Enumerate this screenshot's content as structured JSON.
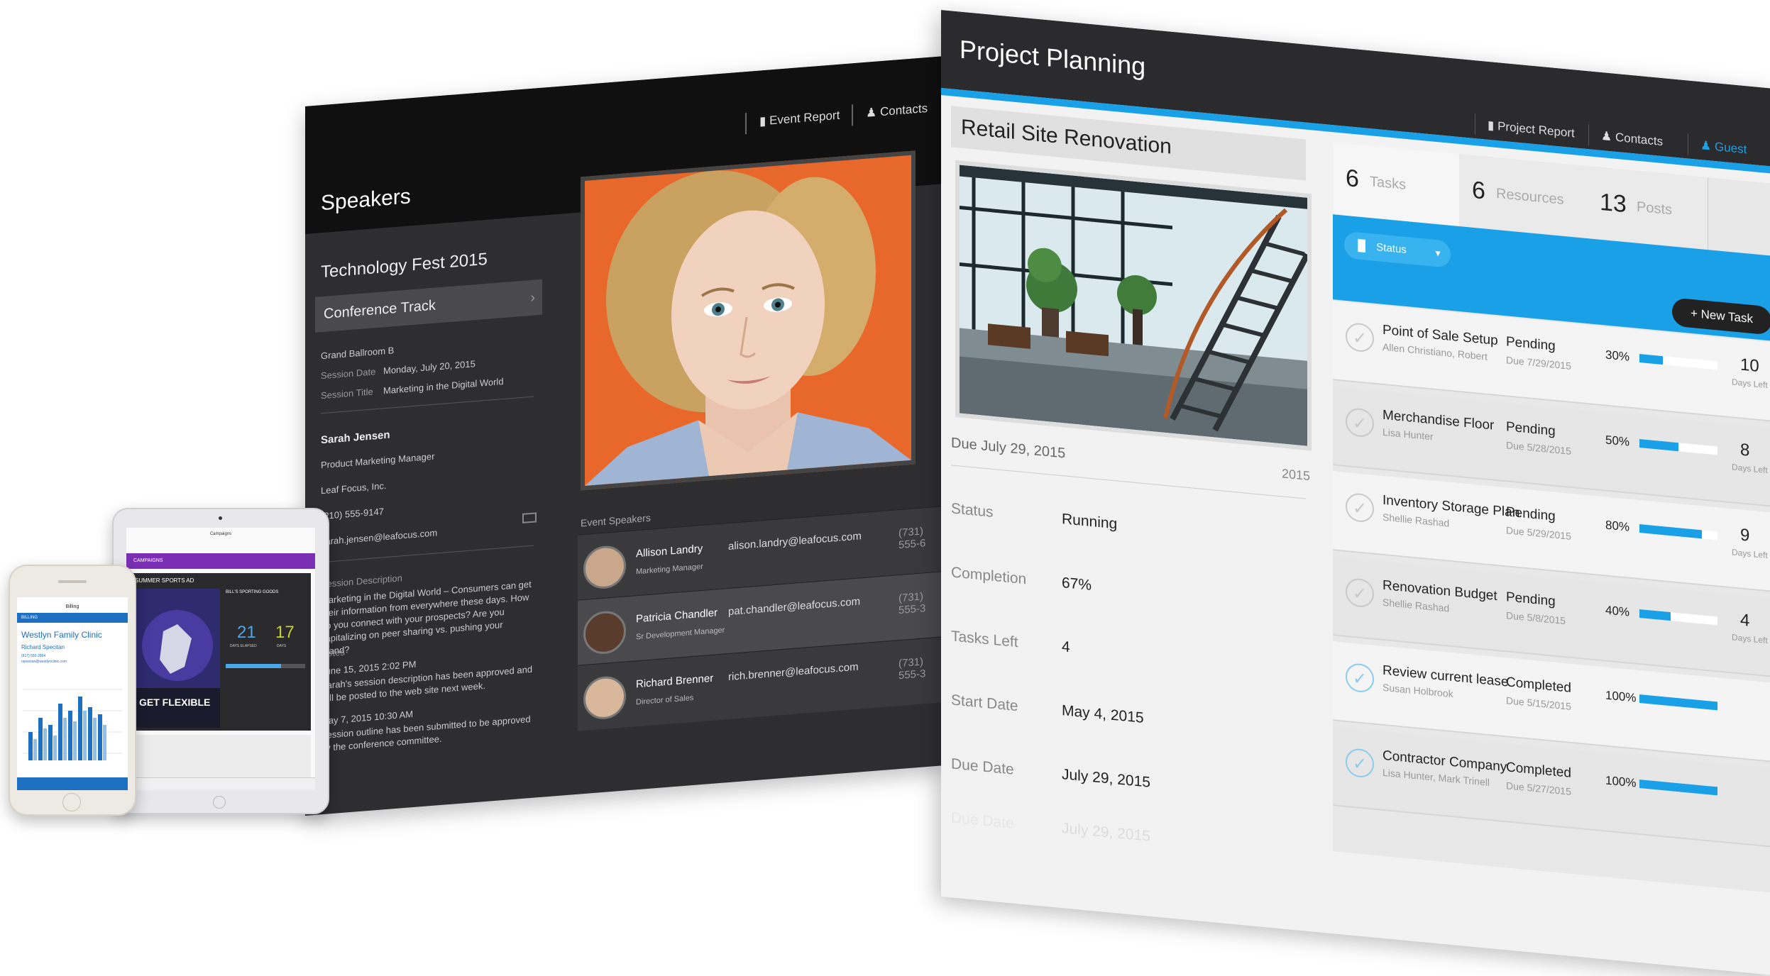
{
  "speakers_app": {
    "title": "Speakers",
    "topbar": {
      "event_report": "Event Report",
      "contacts": "Contacts"
    },
    "event_name": "Technology Fest 2015",
    "track": "Conference Track",
    "room": "Grand Ballroom B",
    "session_date_label": "Session Date",
    "session_date": "Monday, July 20, 2015",
    "session_title_label": "Session Title",
    "session_title": "Marketing in the Digital World",
    "speaker": {
      "name": "Sarah Jensen",
      "title": "Product Marketing Manager",
      "company": "Leaf Focus, Inc.",
      "phone": "(210) 555-9147",
      "email": "sarah.jensen@leafocus.com"
    },
    "session_description_label": "Session Description",
    "session_description": "Marketing in the Digital World – Consumers can get their information from everywhere these days. How do you connect with your prospects? Are you capitalizing on peer sharing vs. pushing your brand?",
    "notes_label": "Notes",
    "notes": [
      {
        "date": "June 15, 2015 2:02 PM",
        "text": "Sarah's session description has been approved and will be posted to the web site next week."
      },
      {
        "date": "May 7, 2015 10:30 AM",
        "text": "Session outline has been submitted to be approved by the conference committee."
      }
    ],
    "event_speakers_label": "Event Speakers",
    "event_speakers": [
      {
        "name": "Allison Landry",
        "title": "Marketing Manager",
        "email": "alison.landry@leafocus.com",
        "phone": "(731) 555-6"
      },
      {
        "name": "Patricia Chandler",
        "title": "Sr Development Manager",
        "email": "pat.chandler@leafocus.com",
        "phone": "(731) 555-3"
      },
      {
        "name": "Richard Brenner",
        "title": "Director of Sales",
        "email": "rich.brenner@leafocus.com",
        "phone": "(731) 555-3"
      }
    ]
  },
  "planning_app": {
    "title": "Project Planning",
    "topbar": {
      "project_report": "Project Report",
      "contacts": "Contacts",
      "guest": "Guest"
    },
    "project_name": "Retail Site Renovation",
    "due_text": "Due July 29, 2015",
    "year": "2015",
    "details": [
      {
        "label": "Status",
        "value": "Running"
      },
      {
        "label": "Completion",
        "value": "67%"
      },
      {
        "label": "Tasks Left",
        "value": "4"
      },
      {
        "label": "Start Date",
        "value": "May 4, 2015"
      },
      {
        "label": "Due Date",
        "value": "July 29, 2015"
      }
    ],
    "stats": [
      {
        "num": "6",
        "label": "Tasks"
      },
      {
        "num": "6",
        "label": "Resources"
      },
      {
        "num": "13",
        "label": "Posts"
      }
    ],
    "status_filter": "Status",
    "new_task": "+ New Task",
    "days_left_label": "Days Left",
    "tasks": [
      {
        "name": "Point of Sale Setup",
        "assignee": "Allen Christiano, Robert",
        "status": "Pending",
        "due": "Due 7/29/2015",
        "pct_label": "30%",
        "progress": 0.3,
        "days": "10"
      },
      {
        "name": "Merchandise Floor",
        "assignee": "Lisa Hunter",
        "status": "Pending",
        "due": "Due 5/28/2015",
        "pct_label": "50%",
        "progress": 0.5,
        "days": "8"
      },
      {
        "name": "Inventory Storage Plan",
        "assignee": "Shellie Rashad",
        "status": "Pending",
        "due": "Due 5/29/2015",
        "pct_label": "80%",
        "progress": 0.8,
        "days": "9"
      },
      {
        "name": "Renovation Budget",
        "assignee": "Shellie Rashad",
        "status": "Pending",
        "due": "Due 5/8/2015",
        "pct_label": "40%",
        "progress": 0.4,
        "days": "4"
      },
      {
        "name": "Review current lease",
        "assignee": "Susan Holbrook",
        "status": "Completed",
        "due": "Due 5/15/2015",
        "pct_label": "100%",
        "progress": 1.0,
        "days": ""
      },
      {
        "name": "Contractor Company",
        "assignee": "Lisa Hunter, Mark Trinell",
        "status": "Completed",
        "due": "Due 5/27/2015",
        "pct_label": "100%",
        "progress": 1.0,
        "days": ""
      }
    ],
    "reflection_text": "July 29, 2015",
    "reflection_label": "Due Date"
  },
  "tablet_app": {
    "title": "Campaigns",
    "header": "CAMPAIGNS",
    "campaign": "SUMMER SPORTS AD",
    "client": "BILL'S SPORTING GOODS",
    "poster_text": "GET FLEXIBLE",
    "days_elapsed": "21",
    "days_elapsed_label": "DAYS ELAPSED",
    "days": "17",
    "days_label": "DAYS"
  },
  "phone_app": {
    "title": "Billing",
    "header": "BILLING",
    "clinic": "Westlyn Family Clinic",
    "contact": "Richard Specitan",
    "phone": "(817) 555-2864",
    "email": "rspecitan@westlynclinic.com"
  },
  "colors": {
    "accent_blue": "#1aa0e6",
    "dark_bar": "#2b2b2d",
    "tablet_purple": "#7b2fb5",
    "phone_blue": "#1d6fc1"
  }
}
